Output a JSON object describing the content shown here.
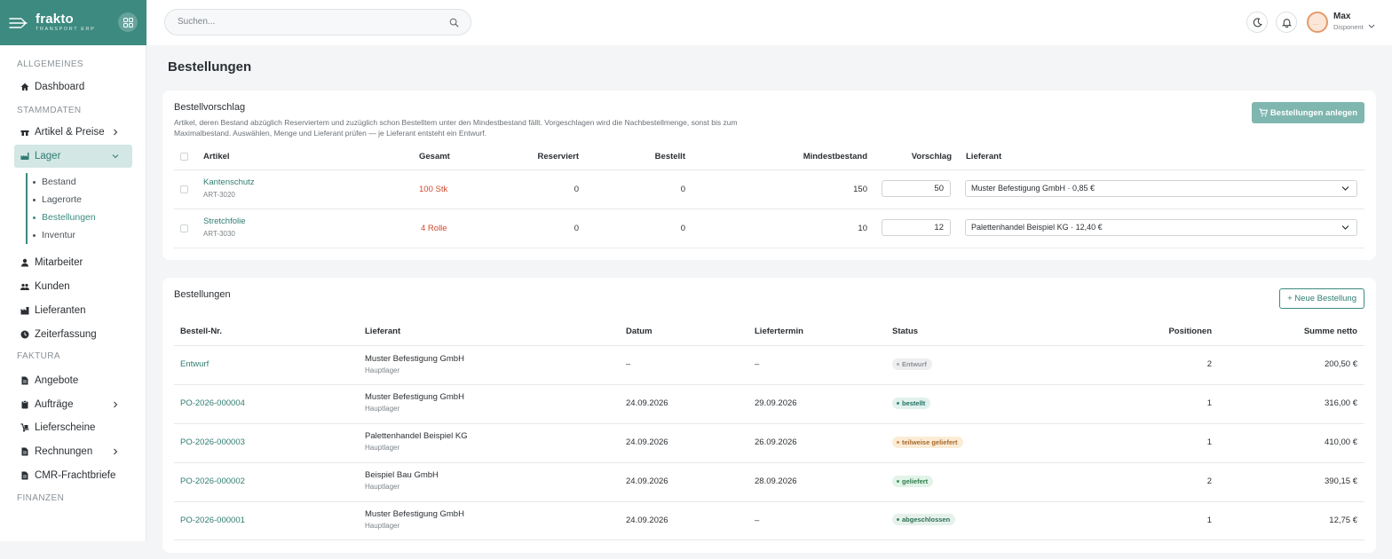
{
  "brand": {
    "name": "frakto",
    "tagline": "TRANSPORT ERP"
  },
  "search": {
    "placeholder": "Suchen..."
  },
  "user": {
    "name": "Max",
    "role": "Disponent",
    "initials": "..."
  },
  "sidebar": {
    "sections": [
      "ALLGEMEINES",
      "STAMMDATEN",
      "FAKTURA",
      "FINANZEN"
    ],
    "items": {
      "dashboard": "Dashboard",
      "artikel": "Artikel & Preise",
      "lager": "Lager",
      "mitarbeiter": "Mitarbeiter",
      "kunden": "Kunden",
      "lieferanten": "Lieferanten",
      "zeiterfassung": "Zeiterfassung",
      "angebote": "Angebote",
      "auftraege": "Aufträge",
      "lieferscheine": "Lieferscheine",
      "rechnungen": "Rechnungen",
      "cmr": "CMR-Frachtbriefe"
    },
    "lager_sub": [
      "Bestand",
      "Lagerorte",
      "Bestellungen",
      "Inventur"
    ]
  },
  "page": {
    "title": "Bestellungen"
  },
  "suggestion": {
    "title": "Bestellvorschlag",
    "description": "Artikel, deren Bestand abzüglich Reserviertem und zuzüglich schon Bestelltem unter den Mindestbestand fällt. Vorgeschlagen wird die Nachbestellmenge, sonst bis zum Maximalbestand. Auswählen, Menge und Lieferant prüfen — je Lieferant entsteht ein Entwurf.",
    "button": "Bestellungen anlegen",
    "columns": {
      "artikel": "Artikel",
      "gesamt": "Gesamt",
      "reserviert": "Reserviert",
      "bestellt": "Bestellt",
      "mindest": "Mindestbestand",
      "vorschlag": "Vorschlag",
      "lieferant": "Lieferant"
    },
    "rows": [
      {
        "name": "Kantenschutz",
        "sku": "ART-3020",
        "gesamt": "100 Stk",
        "reserviert": "0",
        "bestellt": "0",
        "mindest": "150",
        "vorschlag": "50",
        "lieferant": "Muster Befestigung GmbH · 0,85 €"
      },
      {
        "name": "Stretchfolie",
        "sku": "ART-3030",
        "gesamt": "4 Rolle",
        "reserviert": "0",
        "bestellt": "0",
        "mindest": "10",
        "vorschlag": "12",
        "lieferant": "Palettenhandel Beispiel KG · 12,40 €"
      }
    ]
  },
  "orders": {
    "title": "Bestellungen",
    "button": "+ Neue Bestellung",
    "columns": {
      "nr": "Bestell-Nr.",
      "lieferant": "Lieferant",
      "datum": "Datum",
      "liefertermin": "Liefertermin",
      "status": "Status",
      "positionen": "Positionen",
      "summe": "Summe netto"
    },
    "rows": [
      {
        "nr": "Entwurf",
        "lieferant": "Muster Befestigung GmbH",
        "lager": "Hauptlager",
        "datum": "–",
        "liefertermin": "–",
        "status": "Entwurf",
        "positionen": "2",
        "summe": "200,50 €"
      },
      {
        "nr": "PO-2026-000004",
        "lieferant": "Muster Befestigung GmbH",
        "lager": "Hauptlager",
        "datum": "24.09.2026",
        "liefertermin": "29.09.2026",
        "status": "bestellt",
        "positionen": "1",
        "summe": "316,00 €"
      },
      {
        "nr": "PO-2026-000003",
        "lieferant": "Palettenhandel Beispiel KG",
        "lager": "Hauptlager",
        "datum": "24.09.2026",
        "liefertermin": "26.09.2026",
        "status": "teilweise geliefert",
        "positionen": "1",
        "summe": "410,00 €"
      },
      {
        "nr": "PO-2026-000002",
        "lieferant": "Beispiel Bau GmbH",
        "lager": "Hauptlager",
        "datum": "24.09.2026",
        "liefertermin": "28.09.2026",
        "status": "geliefert",
        "positionen": "2",
        "summe": "390,15 €"
      },
      {
        "nr": "PO-2026-000001",
        "lieferant": "Muster Befestigung GmbH",
        "lager": "Hauptlager",
        "datum": "24.09.2026",
        "liefertermin": "–",
        "status": "abgeschlossen",
        "positionen": "1",
        "summe": "12,75 €"
      }
    ]
  },
  "colors": {
    "brand": "#3c8a80",
    "accent": "#2f7d72",
    "danger": "#d0492e"
  }
}
